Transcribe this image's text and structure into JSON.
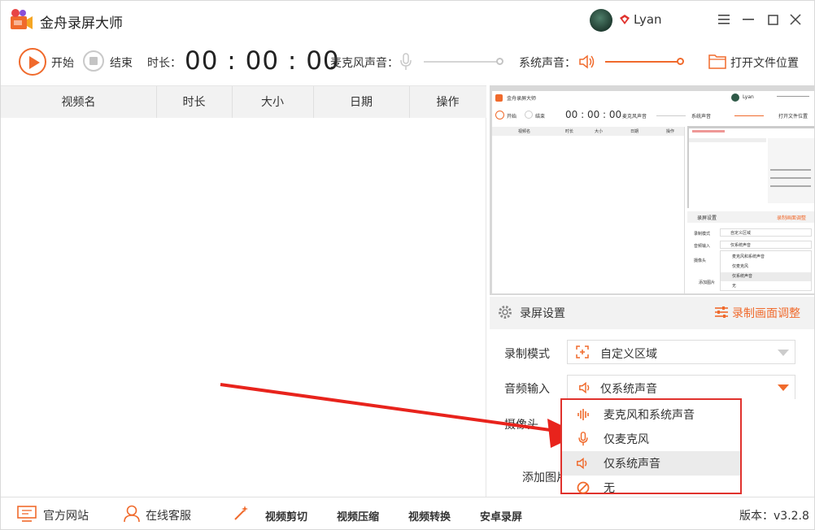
{
  "app": {
    "title": "金舟录屏大师",
    "user": "Lyan"
  },
  "toolbar": {
    "start_label": "开始",
    "stop_label": "结束",
    "duration_label": "时长：",
    "timer": "00 : 00 : 00",
    "mic_label": "麦克风声音：",
    "system_label": "系统声音：",
    "open_folder_label": "打开文件位置"
  },
  "list": {
    "columns": [
      "视频名",
      "时长",
      "大小",
      "日期",
      "操作"
    ]
  },
  "preview": {
    "mini_title": "金舟录屏大师",
    "mini_user": "Lyan",
    "mini_start": "开始",
    "mini_stop": "结束",
    "mini_timer": "00 : 00 : 00",
    "mini_mic": "麦克风声音",
    "mini_system": "系统声音",
    "mini_folder": "打开文件位置",
    "mini_columns": [
      "视频名",
      "时长",
      "大小",
      "日期",
      "操作"
    ],
    "mini_settings": "录屏设置",
    "mini_adjust": "录制画面调整",
    "mini_mode_label": "录制模式",
    "mini_mode_value": "自定义区域",
    "mini_audio_label": "音频输入",
    "mini_audio_value": "仅系统声音",
    "mini_camera": "摄像头",
    "mini_addimg": "添加图片",
    "mini_options": [
      "麦克风和系统声音",
      "仅麦克风",
      "仅系统声音",
      "无"
    ]
  },
  "settings": {
    "title": "录屏设置",
    "adjust_label": "录制画面调整",
    "mode_label": "录制模式",
    "mode_value": "自定义区域",
    "audio_label": "音频输入",
    "audio_value": "仅系统声音",
    "camera_label": "摄像头",
    "add_image_label": "添加图片"
  },
  "audio_options": [
    {
      "label": "麦克风和系统声音",
      "icon": "waveform-icon"
    },
    {
      "label": "仅麦克风",
      "icon": "microphone-icon"
    },
    {
      "label": "仅系统声音",
      "icon": "speaker-icon"
    },
    {
      "label": "无",
      "icon": "none-icon"
    }
  ],
  "footer": {
    "website": "官方网站",
    "service": "在线客服",
    "video_cut": "视频剪切",
    "video_compress": "视频压缩",
    "video_convert": "视频转换",
    "android_record": "安卓录屏",
    "version": "版本：v3.2.8"
  },
  "colors": {
    "accent": "#f06a2c",
    "highlight_border": "#e0322d"
  }
}
